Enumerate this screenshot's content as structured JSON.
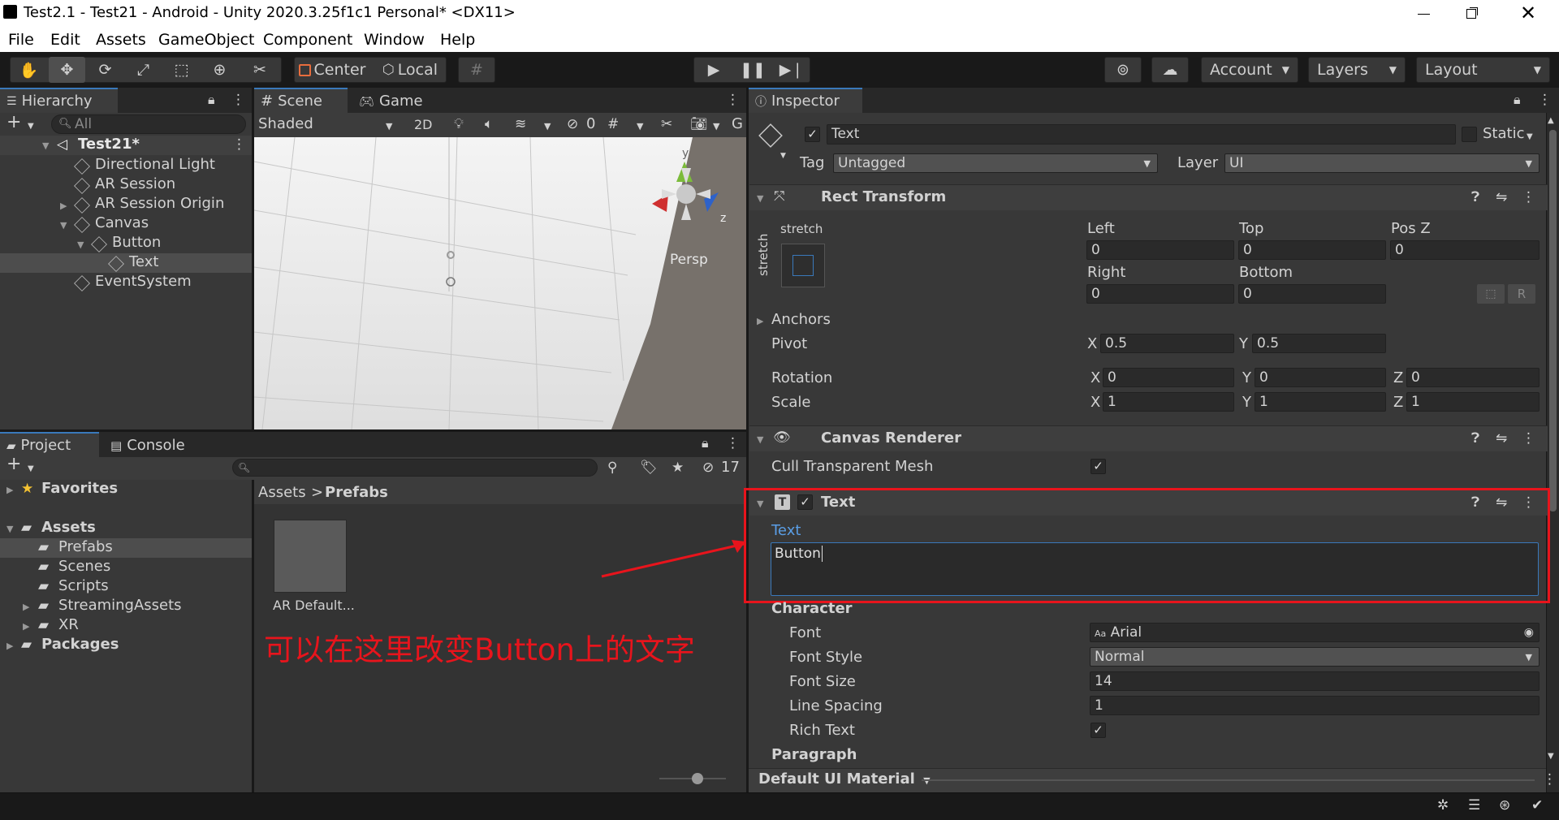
{
  "window": {
    "title": "Test2.1 - Test21 - Android - Unity 2020.3.25f1c1 Personal* <DX11>"
  },
  "menu": [
    "File",
    "Edit",
    "Assets",
    "GameObject",
    "Component",
    "Window",
    "Help"
  ],
  "toolbar": {
    "pivot_label": "Center",
    "space_label": "Local",
    "account_label": "Account",
    "layers_label": "Layers",
    "layout_label": "Layout"
  },
  "hierarchy": {
    "tab": "Hierarchy",
    "search_placeholder": "All",
    "scene_name": "Test21*",
    "items": [
      "Directional Light",
      "AR Session",
      "AR Session Origin",
      "Canvas",
      "Button",
      "Text",
      "EventSystem"
    ]
  },
  "scene": {
    "tabs": [
      "Scene",
      "Game"
    ],
    "shade_mode": "Shaded",
    "mode_2d": "2D",
    "hidden_count": "0",
    "gizmo_overflow": "G",
    "axis_y": "y",
    "axis_z": "z",
    "persp_label": "Persp"
  },
  "project": {
    "tabs": [
      "Project",
      "Console"
    ],
    "hidden_count": "17",
    "favorites": "Favorites",
    "assets": "Assets",
    "folders": [
      "Prefabs",
      "Scenes",
      "Scripts",
      "StreamingAssets",
      "XR"
    ],
    "packages": "Packages",
    "breadcrumb_root": "Assets",
    "breadcrumb_sep": ">",
    "breadcrumb_current": "Prefabs",
    "asset_item": "AR Default..."
  },
  "annotation": {
    "text": "可以在这里改变Button上的文字",
    "color": "#e8141c"
  },
  "inspector": {
    "tab": "Inspector",
    "object_name": "Text",
    "static_label": "Static",
    "tag_label": "Tag",
    "tag_value": "Untagged",
    "layer_label": "Layer",
    "layer_value": "UI",
    "rect_transform": {
      "title": "Rect Transform",
      "anchor_h": "stretch",
      "anchor_v": "stretch",
      "left_label": "Left",
      "left": "0",
      "top_label": "Top",
      "top": "0",
      "posz_label": "Pos Z",
      "posz": "0",
      "right_label": "Right",
      "right": "0",
      "bottom_label": "Bottom",
      "bottom": "0",
      "raw_label": "R",
      "anchors_label": "Anchors",
      "pivot_label": "Pivot",
      "pivot_x": "0.5",
      "pivot_y": "0.5",
      "rotation_label": "Rotation",
      "rot_x": "0",
      "rot_y": "0",
      "rot_z": "0",
      "scale_label": "Scale",
      "scale_x": "1",
      "scale_y": "1",
      "scale_z": "1",
      "x": "X",
      "y": "Y",
      "z": "Z"
    },
    "canvas_renderer": {
      "title": "Canvas Renderer",
      "cull_label": "Cull Transparent Mesh"
    },
    "text_component": {
      "title": "Text",
      "text_label": "Text",
      "text_value": "Button",
      "character_label": "Character",
      "font_label": "Font",
      "font_value": "Arial",
      "font_prefix": "Aa",
      "font_style_label": "Font Style",
      "font_style_value": "Normal",
      "font_size_label": "Font Size",
      "font_size_value": "14",
      "line_spacing_label": "Line Spacing",
      "line_spacing_value": "1",
      "rich_text_label": "Rich Text",
      "paragraph_label": "Paragraph"
    },
    "material_label": "Default UI Material"
  },
  "colors": {
    "accent": "#3a79bb",
    "highlight": "#e8141c",
    "link": "#5a9ee6"
  }
}
